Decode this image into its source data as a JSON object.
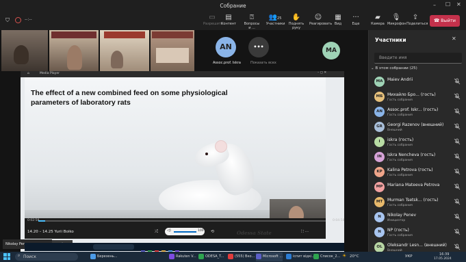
{
  "window": {
    "title": "Собрание"
  },
  "toolbar": {
    "items": [
      {
        "label": "Разрешить",
        "icon": "chat-icon"
      },
      {
        "label": "Контент",
        "icon": "content-icon"
      },
      {
        "label": "Вопросы и ...",
        "icon": "questions-icon"
      },
      {
        "label": "Участники",
        "icon": "people-icon",
        "count": "25"
      },
      {
        "label": "Поднять руку",
        "icon": "hand-icon"
      },
      {
        "label": "Реагировать",
        "icon": "smile-icon"
      },
      {
        "label": "Вид",
        "icon": "grid-icon"
      },
      {
        "label": "Еще",
        "icon": "more-icon"
      },
      {
        "label": "Камера",
        "icon": "camera-off-icon"
      },
      {
        "label": "Микрофон",
        "icon": "mic-off-icon"
      },
      {
        "label": "Поделиться",
        "icon": "share-icon"
      }
    ],
    "leave_label": "Выйти",
    "call_timer": "--:--"
  },
  "tiles": [
    {
      "name": "Assoc.prof. Iskra",
      "initials": "AN",
      "color": "#8ab4e8"
    },
    {
      "name": "Показать всех",
      "initials": "•••",
      "color": "#3a3a3a"
    },
    {
      "name": "",
      "initials": "MA",
      "color": "#9fd3b6"
    }
  ],
  "media_player": {
    "title": "Media Player",
    "time_current": "0:02:58",
    "time_total": "0:04:58",
    "caption": "14.20 – 14.25 Yurii Boiko",
    "volume": "100",
    "watermark": "Odessa State"
  },
  "slide": {
    "title": "The effect of a new combined feed on some physiological parameters of laboratory rats"
  },
  "presenter": {
    "name": "Nikolay Penev"
  },
  "panel": {
    "title": "Участники",
    "search_placeholder": "Введите имя",
    "section_label": "В этом собрании (25)",
    "participants": [
      {
        "initials": "MA",
        "name": "Maiev Andrii",
        "role": "",
        "color": "#9fd3b6"
      },
      {
        "initials": "МБ",
        "name": "Михайло Бро... (гость)",
        "role": "Гость собрания",
        "color": "#e6c07b"
      },
      {
        "initials": "AN",
        "name": "Assoc.prof. Iskr... (гость)",
        "role": "Гость собрания",
        "color": "#8ab4e8"
      },
      {
        "initials": "GR",
        "name": "Georgi Razenov (внешний)",
        "role": "Внешний",
        "color": "#a9bfd9"
      },
      {
        "initials": "I",
        "name": "iskra (гость)",
        "role": "Гость собрания",
        "color": "#b8dca4"
      },
      {
        "initials": "IN",
        "name": "Iskra Nenсheva (гость)",
        "role": "Гость собрания",
        "color": "#d7a3d8"
      },
      {
        "initials": "KP",
        "name": "Kalina Petrova (гость)",
        "role": "Гость собрания",
        "color": "#f0a58a"
      },
      {
        "initials": "MP",
        "name": "Mariana Mateeva Petrova",
        "role": "",
        "color": "#f2a1a1"
      },
      {
        "initials": "MT",
        "name": "Murman Tsetsk... (гость)",
        "role": "Гость собрания",
        "color": "#e8b96b"
      },
      {
        "initials": "N",
        "name": "Nikolay Penev",
        "role": "Инициатор",
        "color": "#a8c5f0"
      },
      {
        "initials": "N",
        "name": "NP (гость)",
        "role": "Гость собрания",
        "color": "#a8c5f0"
      },
      {
        "initials": "OL",
        "name": "Oleksandr Lesn... (внешний)",
        "role": "Внешний",
        "color": "#b9d7a5"
      }
    ]
  },
  "taskbar": {
    "search_placeholder": "Поиск",
    "apps": [
      {
        "label": "Березень...",
        "color": "#4c9be8"
      },
      {
        "label": "Rakuten V...",
        "color": "#7e4be0"
      },
      {
        "label": "ODESA_T...",
        "color": "#2ea44f"
      },
      {
        "label": "(555) Вко...",
        "color": "#e03c3c"
      },
      {
        "label": "Microsoft ...",
        "color": "#5b5fc7"
      },
      {
        "label": "іспит відкі...",
        "color": "#2b7cd3"
      },
      {
        "label": "Список_2...",
        "color": "#2ea44f"
      }
    ],
    "weather": "20°C",
    "lang": "УКР",
    "time": "16:39",
    "date": "17.05.2024"
  },
  "colors": {
    "accent": "#6264a7",
    "leave": "#c4314b",
    "background": "#1f1f1f"
  }
}
